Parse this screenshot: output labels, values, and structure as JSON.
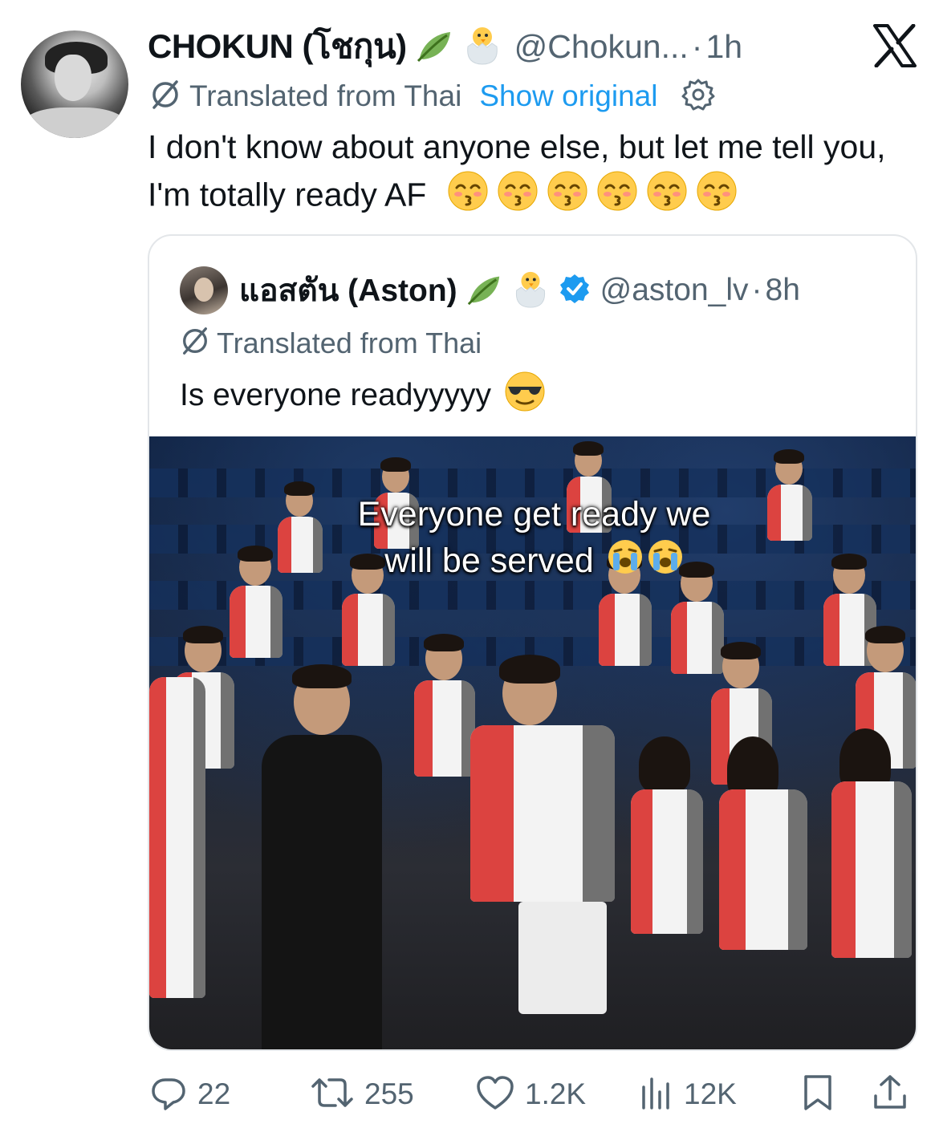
{
  "tweet": {
    "author_name": "CHOKUN (โชกุน)",
    "handle": "@Chokun...",
    "separator": "·",
    "time": "1h",
    "translated_label": "Translated from Thai",
    "show_original": "Show original",
    "text": "I don't know about anyone else, but let me tell you, I'm totally ready AF",
    "emoji_count": 6
  },
  "quote": {
    "author_name": "แอสตัน (Aston)",
    "handle": "@aston_lv",
    "separator": "·",
    "time": "8h",
    "translated_label": "Translated from Thai",
    "text": "Is everyone readyyyyy",
    "verified": true,
    "media": {
      "caption_line1": "Everyone get ready we",
      "caption_line2": "will be served"
    }
  },
  "actions": {
    "replies": "22",
    "reposts": "255",
    "likes": "1.2K",
    "views": "12K"
  },
  "icons": {
    "leaf": "leaf-emoji-icon",
    "chick": "hatching-chick-emoji-icon",
    "verified": "verified-badge-icon",
    "x_logo": "x-logo-icon"
  },
  "colors": {
    "text": "#0f1419",
    "secondary": "#536471",
    "link": "#1d9bf0",
    "border": "#e3e6e9"
  }
}
